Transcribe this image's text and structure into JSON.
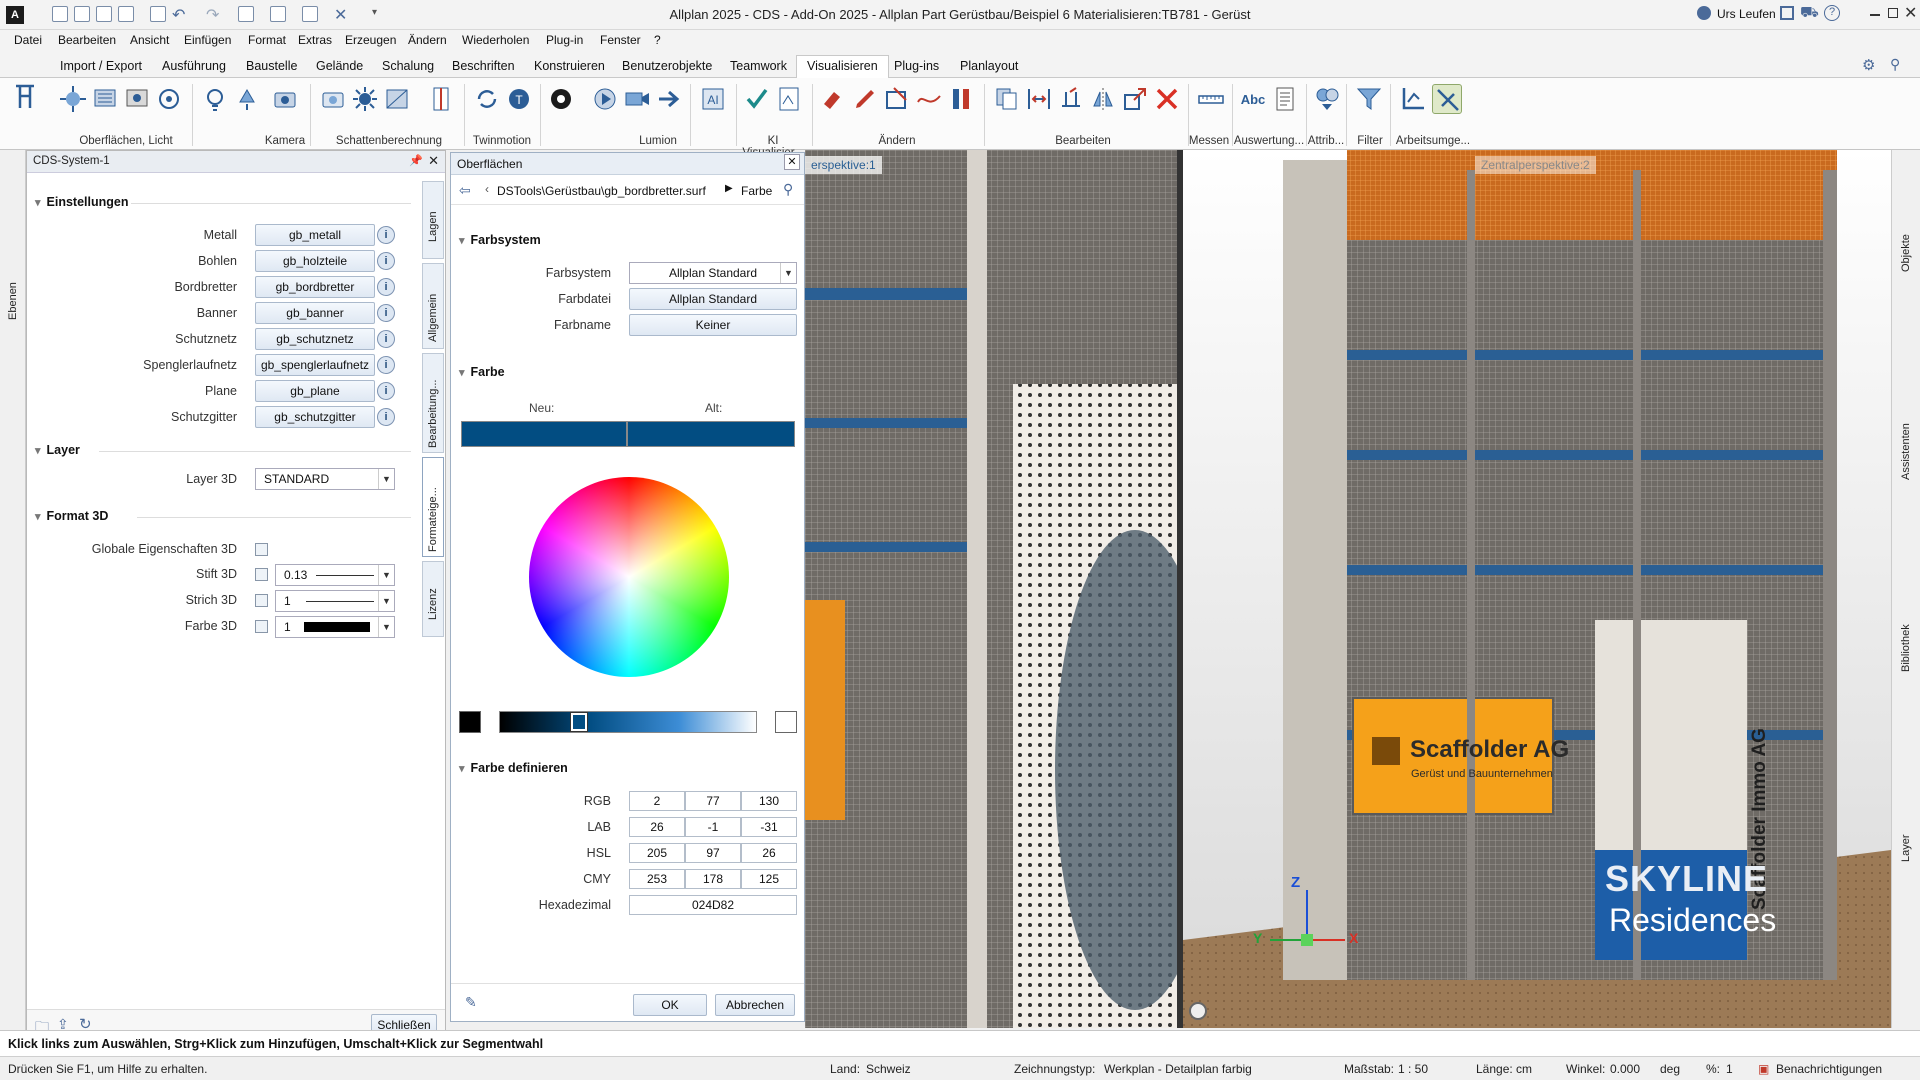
{
  "window": {
    "title": "Allplan 2025 - CDS - Add-On 2025 - Allplan Part Gerüstbau/Beispiel 6 Materialisieren:TB781 - Gerüst",
    "user": "Urs Leufen"
  },
  "menubar": [
    "Datei",
    "Bearbeiten",
    "Ansicht",
    "Einfügen",
    "Format",
    "Extras",
    "Erzeugen",
    "Ändern",
    "Wiederholen",
    "Plug-in",
    "Fenster",
    "?"
  ],
  "ribbon_tabs": [
    "Import / Export",
    "Ausführung",
    "Baustelle",
    "Gelände",
    "Schalung",
    "Beschriften",
    "Konstruieren",
    "Benutzerobjekte",
    "Teamwork",
    "Visualisieren",
    "Plug-ins",
    "Planlayout"
  ],
  "ribbon_active_tab": "Visualisieren",
  "ribbon_groups": [
    "Oberflächen, Licht",
    "Kamera",
    "Schattenberechnung",
    "Twinmotion",
    "Lumion",
    "KI Visualisier...",
    "Ändern",
    "Bearbeiten",
    "Messen",
    "Auswertung...",
    "Attrib...",
    "Filter",
    "Arbeitsumge..."
  ],
  "left_strip": {
    "tab": "Ebenen"
  },
  "panel": {
    "title": "CDS-System-1",
    "sections": {
      "settings": "Einstellungen",
      "layer": "Layer",
      "format3d": "Format 3D"
    },
    "materials": [
      {
        "label": "Metall",
        "value": "gb_metall"
      },
      {
        "label": "Bohlen",
        "value": "gb_holzteile"
      },
      {
        "label": "Bordbretter",
        "value": "gb_bordbretter"
      },
      {
        "label": "Banner",
        "value": "gb_banner"
      },
      {
        "label": "Schutznetz",
        "value": "gb_schutznetz"
      },
      {
        "label": "Spenglerlaufnetz",
        "value": "gb_spenglerlaufnetz"
      },
      {
        "label": "Plane",
        "value": "gb_plane"
      },
      {
        "label": "Schutzgitter",
        "value": "gb_schutzgitter"
      }
    ],
    "info_glyph": "i",
    "layer3d": {
      "label": "Layer 3D",
      "value": "STANDARD"
    },
    "format": {
      "global": "Globale Eigenschaften 3D",
      "pen": {
        "label": "Stift 3D",
        "value": "0.13"
      },
      "line": {
        "label": "Strich 3D",
        "value": "1"
      },
      "color": {
        "label": "Farbe 3D",
        "value": "1"
      }
    },
    "side_tabs": [
      "Lagen",
      "Allgemein",
      "Bearbeitung...",
      "Formateige...",
      "Lizenz"
    ],
    "close_button": "Schließen"
  },
  "dialog": {
    "title": "Oberflächen",
    "path": "DSTools\\Gerüstbau\\gb_bordbretter.surf",
    "path_tail": "Farbe",
    "farbsystem_section": "Farbsystem",
    "farbsystem": {
      "label": "Farbsystem",
      "value": "Allplan Standard"
    },
    "farbdatei": {
      "label": "Farbdatei",
      "value": "Allplan Standard"
    },
    "farbname": {
      "label": "Farbname",
      "value": "Keiner"
    },
    "farbe_section": "Farbe",
    "new_label": "Neu:",
    "old_label": "Alt:",
    "current_color": "#024D82",
    "brightness": 0.3,
    "define_section": "Farbe definieren",
    "rgb": {
      "label": "RGB",
      "values": [
        "2",
        "77",
        "130"
      ]
    },
    "lab": {
      "label": "LAB",
      "values": [
        "26",
        "-1",
        "-31"
      ]
    },
    "hsl": {
      "label": "HSL",
      "values": [
        "205",
        "97",
        "26"
      ]
    },
    "cmy": {
      "label": "CMY",
      "values": [
        "253",
        "178",
        "125"
      ]
    },
    "hex": {
      "label": "Hexadezimal",
      "value": "024D82"
    },
    "ok": "OK",
    "cancel": "Abbrechen"
  },
  "viewports": {
    "left_label": "erspektive:1",
    "right_label": "Zentralperspektive:2",
    "banner_company": "Scaffolder AG",
    "banner_company_sub": "Gerüst und Bauunternehmen",
    "banner_side": "Scaffolder Immo AG",
    "banner_brand_1": "SKYLINE",
    "banner_brand_2": "Residences",
    "axis_z": "Z",
    "axis_y": "Y",
    "axis_x": "X"
  },
  "right_strip": [
    "Objekte",
    "Assistenten",
    "Bibliothek",
    "Layer"
  ],
  "hint": "Klick links zum Auswählen, Strg+Klick zum Hinzufügen, Umschalt+Klick zur Segmentwahl",
  "status": {
    "help": "Drücken Sie F1, um Hilfe zu erhalten.",
    "country_label": "Land:",
    "country": "Schweiz",
    "drawtype_label": "Zeichnungstyp:",
    "drawtype": "Werkplan - Detailplan farbig",
    "scale_label": "Maßstab:",
    "scale": "1 : 50",
    "length_label": "Länge:",
    "length": "cm",
    "angle_label": "Winkel:",
    "angle": "0.000",
    "angle_unit": "deg",
    "percent_label": "%:",
    "percent": "1",
    "notifications": "Benachrichtigungen"
  },
  "colors": {
    "accent": "#024D82",
    "orange": "#E8862A",
    "banner_yellow": "#F5A11A",
    "banner_blue": "#1D5EA8"
  }
}
